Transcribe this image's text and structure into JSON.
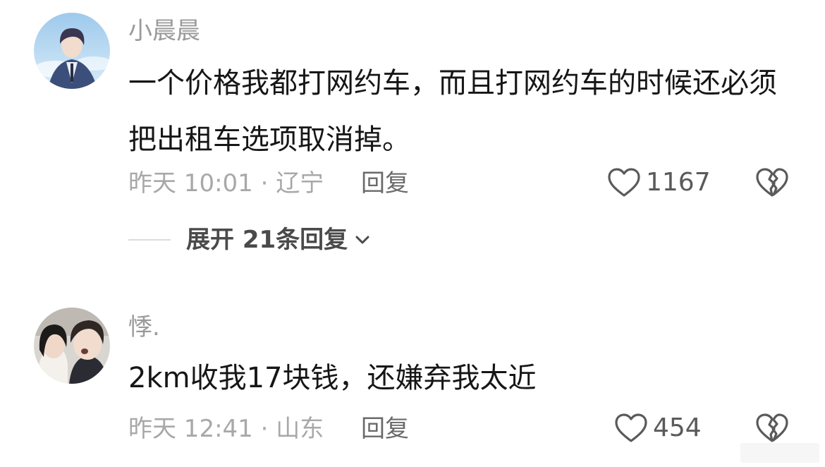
{
  "comments": [
    {
      "username": "小晨晨",
      "content": "一个价格我都打网约车，而且打网约车的时候还必须把出租车选项取消掉。",
      "time_location": "昨天 10:01 · 辽宁",
      "reply_label": "回复",
      "likes": "1167",
      "expand_label": "展开 21条回复"
    },
    {
      "username": "悸.",
      "content": "2km收我17块钱，还嫌弃我太近",
      "time_location": "昨天 12:41 · 山东",
      "reply_label": "回复",
      "likes": "454"
    }
  ],
  "icons": {
    "like": "heart-outline-icon",
    "dislike": "broken-heart-icon",
    "expand": "chevron-down-icon"
  },
  "colors": {
    "text_primary": "#161616",
    "text_secondary": "#9a9a9a",
    "icon": "#5a5a5a"
  }
}
